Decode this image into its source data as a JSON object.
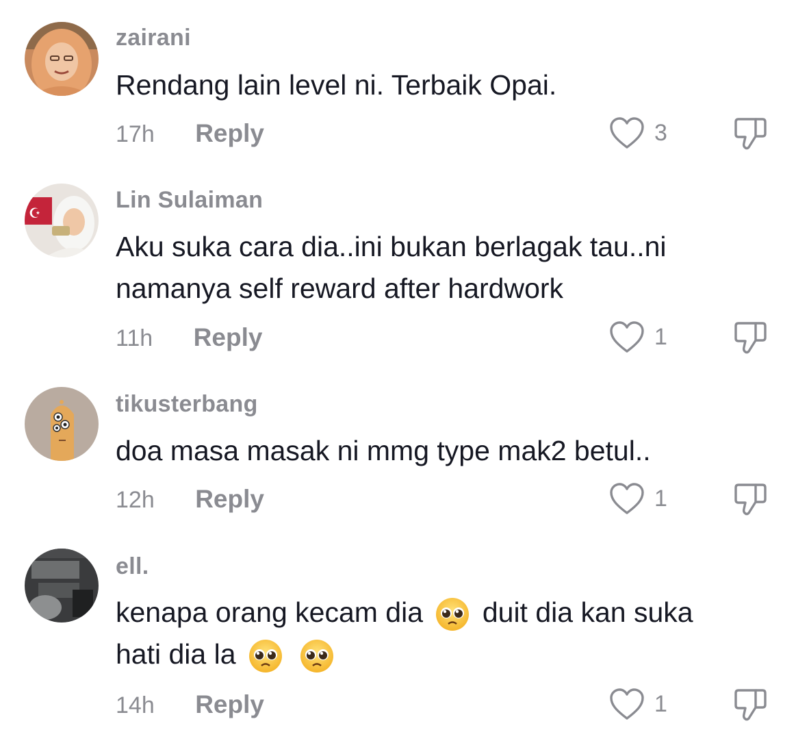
{
  "comments": [
    {
      "username": "zairani",
      "lines": [
        "Rendang lain level ni. Terbaik Opai."
      ],
      "time": "17h",
      "reply_label": "Reply",
      "likes": "3",
      "avatar_icon": "avatar-photo-woman-orange-hijab"
    },
    {
      "username": "Lin Sulaiman",
      "lines": [
        "Aku suka cara dia..ini bukan berlagak tau..ni",
        "namanya self reward after hardwork"
      ],
      "time": "11h",
      "reply_label": "Reply",
      "likes": "1",
      "avatar_icon": "avatar-photo-woman-white-hijab"
    },
    {
      "username": "tikusterbang",
      "lines": [
        "doa masa masak ni mmg type mak2 betul.."
      ],
      "time": "12h",
      "reply_label": "Reply",
      "likes": "1",
      "avatar_icon": "avatar-cartoon-creature"
    },
    {
      "username": "ell.",
      "lines": [
        "kenapa orang kecam dia",
        "duit dia kan suka",
        "hati dia la"
      ],
      "time": "14h",
      "reply_label": "Reply",
      "likes": "1",
      "avatar_icon": "avatar-photo-dark-blurry",
      "emoji": "pleading-face-emoji"
    }
  ],
  "colors": {
    "text": "#161823",
    "muted": "#8a8b91",
    "background": "#ffffff"
  },
  "icons": {
    "like": "heart-outline-icon",
    "dislike": "thumbs-down-outline-icon"
  }
}
